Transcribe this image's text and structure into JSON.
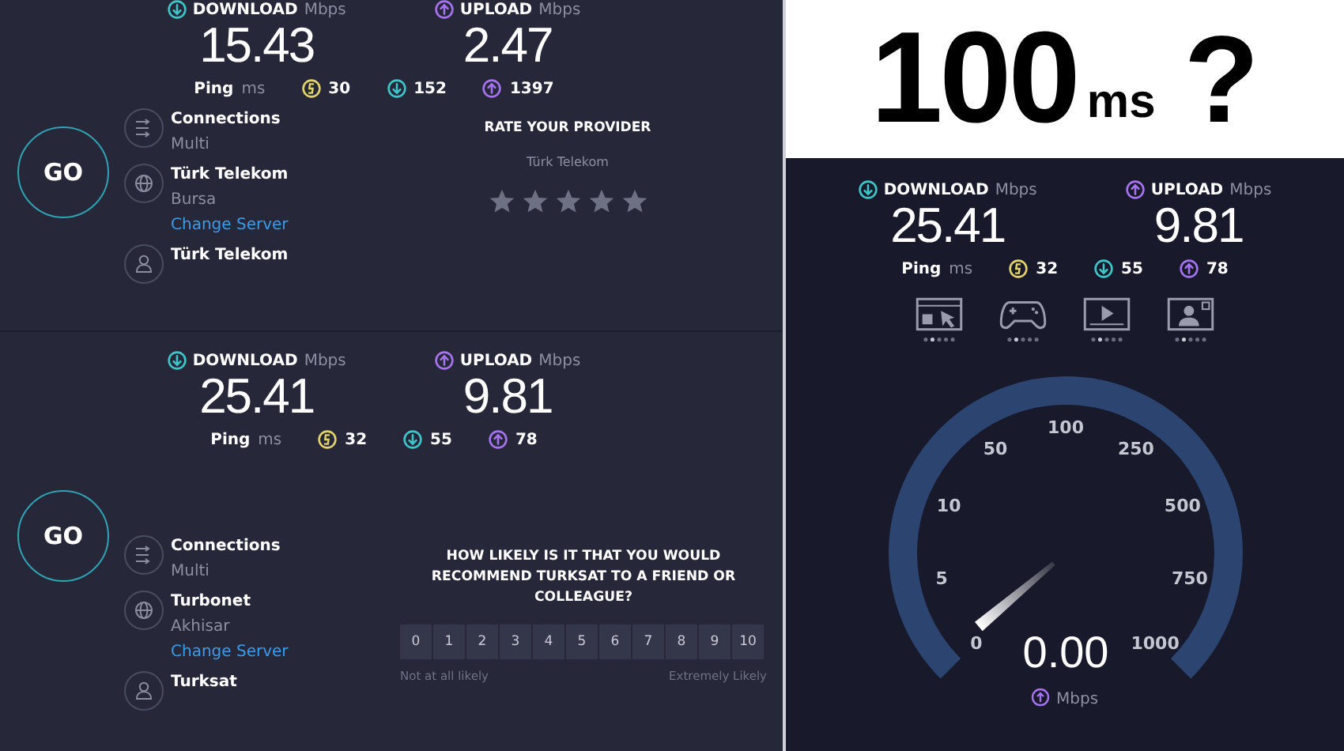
{
  "left_panels": [
    {
      "results": {
        "download": {
          "label": "DOWNLOAD",
          "unit": "Mbps",
          "value": "15.43"
        },
        "upload": {
          "label": "UPLOAD",
          "unit": "Mbps",
          "value": "2.47"
        },
        "ping": {
          "label": "Ping",
          "unit": "ms",
          "values": [
            {
              "kind": "jitter",
              "value": "30"
            },
            {
              "kind": "download",
              "value": "152"
            },
            {
              "kind": "upload",
              "value": "1397"
            }
          ]
        }
      },
      "go": "GO",
      "server": [
        {
          "kind": "connections",
          "title": "Connections",
          "subtitle": "Multi"
        },
        {
          "kind": "server",
          "title": "Türk Telekom",
          "subtitle": "Bursa",
          "link": "Change Server"
        },
        {
          "kind": "provider",
          "title": "Türk Telekom"
        }
      ],
      "side": {
        "kind": "rate",
        "title": "RATE YOUR PROVIDER",
        "provider": "Türk Telekom",
        "stars": 0
      }
    },
    {
      "results": {
        "download": {
          "label": "DOWNLOAD",
          "unit": "Mbps",
          "value": "25.41"
        },
        "upload": {
          "label": "UPLOAD",
          "unit": "Mbps",
          "value": "9.81"
        },
        "ping": {
          "label": "Ping",
          "unit": "ms",
          "values": [
            {
              "kind": "jitter",
              "value": "32"
            },
            {
              "kind": "download",
              "value": "55"
            },
            {
              "kind": "upload",
              "value": "78"
            }
          ]
        }
      },
      "go": "GO",
      "server": [
        {
          "kind": "connections",
          "title": "Connections",
          "subtitle": "Multi"
        },
        {
          "kind": "server",
          "title": "Turbonet",
          "subtitle": "Akhisar",
          "link": "Change Server"
        },
        {
          "kind": "provider",
          "title": "Turksat"
        }
      ],
      "side": {
        "kind": "nps",
        "question": "HOW LIKELY IS IT THAT YOU WOULD RECOMMEND TURKSAT TO A FRIEND OR COLLEAGUE?",
        "scale": [
          "0",
          "1",
          "2",
          "3",
          "4",
          "5",
          "6",
          "7",
          "8",
          "9",
          "10"
        ],
        "low": "Not at all likely",
        "high": "Extremely Likely"
      }
    }
  ],
  "headline": {
    "value": "100",
    "unit": "ms",
    "mark": "?"
  },
  "right_panel": {
    "results": {
      "download": {
        "label": "DOWNLOAD",
        "unit": "Mbps",
        "value": "25.41"
      },
      "upload": {
        "label": "UPLOAD",
        "unit": "Mbps",
        "value": "9.81"
      },
      "ping": {
        "label": "Ping",
        "unit": "ms",
        "values": [
          {
            "kind": "jitter",
            "value": "32"
          },
          {
            "kind": "download",
            "value": "55"
          },
          {
            "kind": "upload",
            "value": "78"
          }
        ]
      }
    },
    "activities": [
      {
        "kind": "browsing"
      },
      {
        "kind": "gaming"
      },
      {
        "kind": "video"
      },
      {
        "kind": "call"
      }
    ],
    "gauge": {
      "ticks": [
        "0",
        "5",
        "10",
        "50",
        "100",
        "250",
        "500",
        "750",
        "1000"
      ],
      "value": "0.00",
      "unit": "Mbps"
    }
  }
}
